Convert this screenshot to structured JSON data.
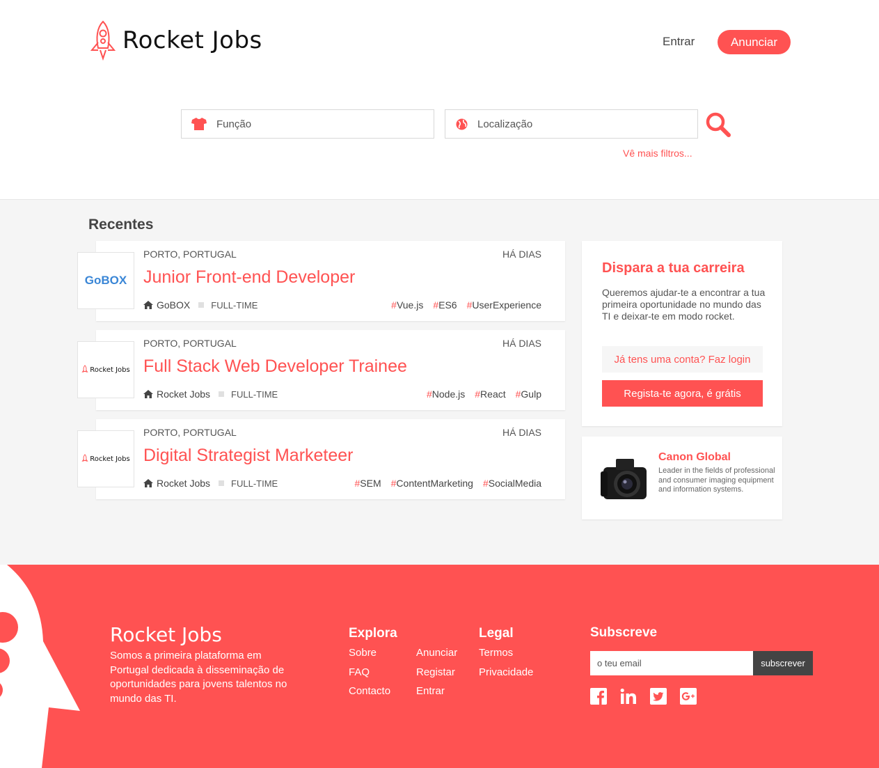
{
  "header": {
    "brand": "Rocket Jobs",
    "nav": {
      "login": "Entrar",
      "post": "Anunciar"
    },
    "search": {
      "role_placeholder": "Função",
      "location_placeholder": "Localização",
      "more_filters": "Vê mais filtros..."
    }
  },
  "main": {
    "recent_title": "Recentes",
    "jobs": [
      {
        "logo_text": "GoBOX",
        "location": "PORTO, PORTUGAL",
        "date": "HÁ DIAS",
        "title": "Junior Front-end Developer",
        "company": "GoBOX",
        "type": "FULL-TIME",
        "tags": [
          "Vue.js",
          "ES6",
          "UserExperience"
        ]
      },
      {
        "logo_text": "Rocket Jobs",
        "location": "PORTO, PORTUGAL",
        "date": "HÁ DIAS",
        "title": "Full Stack Web Developer Trainee",
        "company": "Rocket Jobs",
        "type": "FULL-TIME",
        "tags": [
          "Node.js",
          "React",
          "Gulp"
        ]
      },
      {
        "logo_text": "Rocket Jobs",
        "location": "PORTO, PORTUGAL",
        "date": "HÁ DIAS",
        "title": "Digital Strategist Marketeer",
        "company": "Rocket Jobs",
        "type": "FULL-TIME",
        "tags": [
          "SEM",
          "ContentMarketing",
          "SocialMedia"
        ]
      }
    ],
    "career": {
      "title": "Dispara a tua carreira",
      "text": "Queremos ajudar-te a encontrar a tua primeira oportunidade no mundo das TI e deixar-te em modo rocket.",
      "login": "Já tens uma conta? Faz login",
      "register": "Regista-te agora, é grátis"
    },
    "ad": {
      "title": "Canon Global",
      "text": "Leader in the fields of professional and consumer imaging equipment and information systems."
    }
  },
  "footer": {
    "brand": "Rocket Jobs",
    "about": "Somos a primeira plataforma em Portugal dedicada à disseminação de oportunidades para jovens talentos no mundo das TI.",
    "explore": {
      "title": "Explora",
      "col1": [
        "Sobre",
        "FAQ",
        "Contacto"
      ],
      "col2": [
        "Anunciar",
        "Registar",
        "Entrar"
      ]
    },
    "legal": {
      "title": "Legal",
      "links": [
        "Termos",
        "Privacidade"
      ]
    },
    "subscribe": {
      "title": "Subscreve",
      "placeholder": "o teu email",
      "button": "subscrever"
    },
    "social_icons": [
      "facebook-icon",
      "linkedin-icon",
      "twitter-icon",
      "google-plus-icon"
    ]
  },
  "colors": {
    "accent": "#ff5252",
    "background": "#f5f5f5",
    "dark_button": "#444444"
  }
}
